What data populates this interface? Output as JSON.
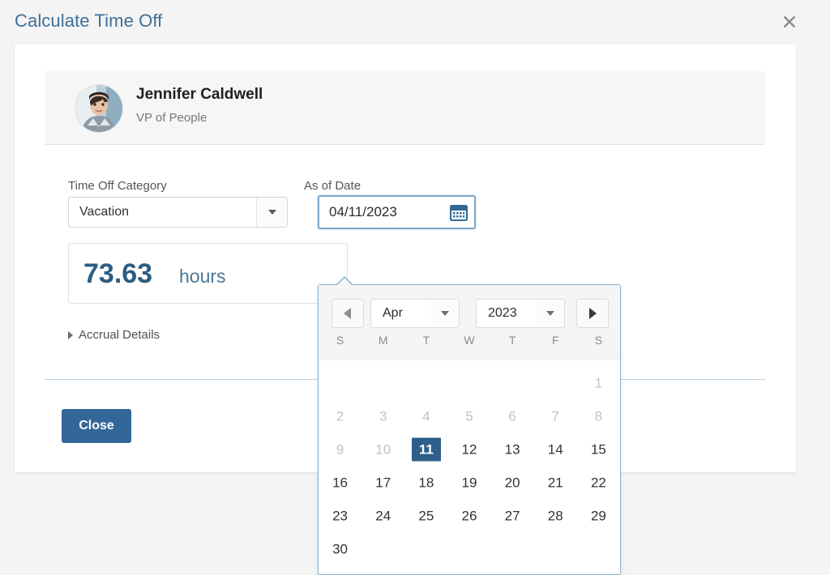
{
  "dialog": {
    "title": "Calculate Time Off",
    "close_icon": "close-x-icon"
  },
  "employee": {
    "name": "Jennifer Caldwell",
    "job_title": "VP of People",
    "avatar_icon": "avatar-photo"
  },
  "form": {
    "category": {
      "label": "Time Off Category",
      "value": "Vacation",
      "arrow_icon": "chevron-down-icon"
    },
    "as_of_date": {
      "label": "As of Date",
      "value": "04/11/2023",
      "calendar_icon": "calendar-icon"
    },
    "balance": {
      "value": "73.63",
      "unit": "hours"
    },
    "accrual": {
      "label": "Accrual Details",
      "caret_icon": "caret-right-icon"
    }
  },
  "footer": {
    "close_label": "Close"
  },
  "calendar": {
    "prev_icon": "caret-left-icon",
    "next_icon": "caret-right-icon",
    "month": "Apr",
    "year": "2023",
    "month_arrow_icon": "chevron-down-icon",
    "year_arrow_icon": "chevron-down-icon",
    "weekdays": [
      "S",
      "M",
      "T",
      "W",
      "T",
      "F",
      "S"
    ],
    "lead_blanks": 6,
    "days": [
      {
        "n": "1",
        "state": "disabled"
      },
      {
        "n": "2",
        "state": "disabled"
      },
      {
        "n": "3",
        "state": "disabled"
      },
      {
        "n": "4",
        "state": "disabled"
      },
      {
        "n": "5",
        "state": "disabled"
      },
      {
        "n": "6",
        "state": "disabled"
      },
      {
        "n": "7",
        "state": "disabled"
      },
      {
        "n": "8",
        "state": "disabled"
      },
      {
        "n": "9",
        "state": "disabled"
      },
      {
        "n": "10",
        "state": "disabled"
      },
      {
        "n": "11",
        "state": "selected"
      },
      {
        "n": "12",
        "state": "normal"
      },
      {
        "n": "13",
        "state": "normal"
      },
      {
        "n": "14",
        "state": "normal"
      },
      {
        "n": "15",
        "state": "normal"
      },
      {
        "n": "16",
        "state": "normal"
      },
      {
        "n": "17",
        "state": "normal"
      },
      {
        "n": "18",
        "state": "normal"
      },
      {
        "n": "19",
        "state": "normal"
      },
      {
        "n": "20",
        "state": "normal"
      },
      {
        "n": "21",
        "state": "normal"
      },
      {
        "n": "22",
        "state": "normal"
      },
      {
        "n": "23",
        "state": "normal"
      },
      {
        "n": "24",
        "state": "normal"
      },
      {
        "n": "25",
        "state": "normal"
      },
      {
        "n": "26",
        "state": "normal"
      },
      {
        "n": "27",
        "state": "normal"
      },
      {
        "n": "28",
        "state": "normal"
      },
      {
        "n": "29",
        "state": "normal"
      },
      {
        "n": "30",
        "state": "normal"
      }
    ]
  },
  "colors": {
    "title_blue": "#3f6f98",
    "accent_blue": "#336699",
    "selected_day": "#2e5f8a",
    "balance_blue": "#2c5d82",
    "popup_border": "#86b0cf",
    "page_bg": "#f4f4f4"
  }
}
